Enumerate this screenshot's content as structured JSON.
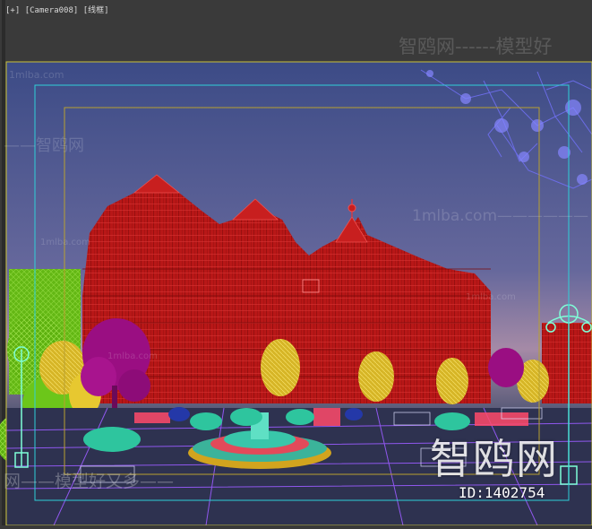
{
  "viewport": {
    "label_plus": "[+]",
    "label_camera": "[Camera008]",
    "label_mode": "[线框]"
  },
  "watermarks": {
    "top": "智鸥网------模型好",
    "left": "——智鸥网",
    "right": "1mlba.com—————— 智鸥网",
    "site1": "1mlba.com",
    "site2": "",
    "site3": "1mlba.com",
    "site4": "1mlba.com",
    "site5": "1mlba.com",
    "bottom": "网——模型好又多——",
    "big": "智鸥网",
    "id": "ID:1402754"
  },
  "colors": {
    "ui_background": "#3a3a3a",
    "safe_frame_outer": "#c9c23a",
    "safe_frame_action": "#2fd0d8",
    "safe_frame_title": "#b8a030",
    "building_wire": "#c41e1e",
    "tree_green": "#6cc61a",
    "tree_purple": "#9a0e82",
    "tree_yellow": "#e7c830",
    "lamp_cyan": "#7fffd8",
    "ground_purple": "#9a5cff"
  }
}
